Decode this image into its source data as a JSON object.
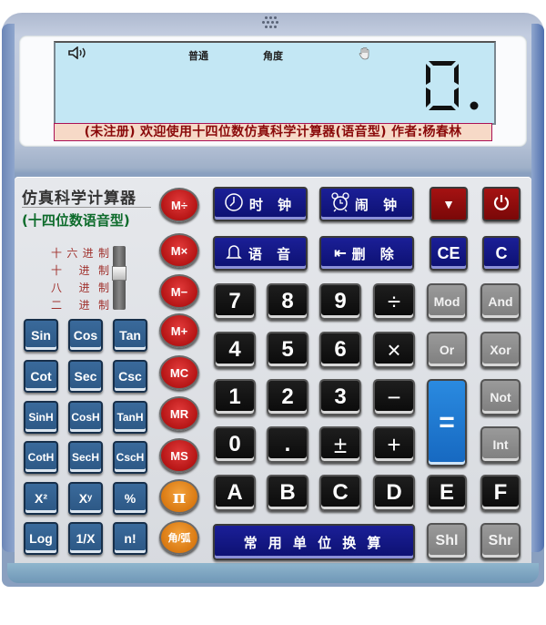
{
  "display": {
    "sound_icon": "speaker-icon",
    "mode_label": "普通",
    "angle_label": "角度",
    "hand_icon": "hand-icon",
    "value": "0."
  },
  "banner": "(未注册) 欢迎使用十四位数仿真科学计算器(语音型) 作者:杨春林",
  "branding": {
    "title": "仿真科学计算器",
    "subtitle": "(十四位数语音型)"
  },
  "base_selector": {
    "options": [
      [
        "十",
        "六",
        "进",
        "制"
      ],
      [
        "十",
        "",
        "进",
        "制"
      ],
      [
        "八",
        "",
        "进",
        "制"
      ],
      [
        "二",
        "",
        "进",
        "制"
      ]
    ],
    "selected_index": 1
  },
  "top_keys": {
    "clock": "时 钟",
    "alarm": "闹 钟",
    "voice": "语 音",
    "delete": "删 除",
    "delete_icon": "⇤",
    "dropdown": "▼",
    "power": "⏻",
    "ce": "CE",
    "c": "C"
  },
  "memory_keys": [
    "M÷",
    "M×",
    "M−",
    "M+",
    "MC",
    "MR",
    "MS"
  ],
  "special_keys": [
    "π",
    "角/弧"
  ],
  "sci_keys": [
    [
      "Sin",
      "Cos",
      "Tan"
    ],
    [
      "Cot",
      "Sec",
      "Csc"
    ],
    [
      "SinH",
      "CosH",
      "TanH"
    ],
    [
      "CotH",
      "SecH",
      "CscH"
    ],
    [
      "X²",
      "Xʸ",
      "%"
    ],
    [
      "Log",
      "1/X",
      "n!"
    ]
  ],
  "num_keys": [
    [
      "7",
      "8",
      "9",
      "÷"
    ],
    [
      "4",
      "5",
      "6",
      "×"
    ],
    [
      "1",
      "2",
      "3",
      "−"
    ],
    [
      "0",
      ".",
      "±",
      "+"
    ],
    [
      "A",
      "B",
      "C",
      "D"
    ]
  ],
  "logic_keys": {
    "mod": "Mod",
    "and": "And",
    "or": "Or",
    "xor": "Xor",
    "not": "Not",
    "int": "Int",
    "e": "E",
    "f": "F",
    "shl": "Shl",
    "shr": "Shr",
    "equals": "="
  },
  "unit_convert": "常 用 单 位 换 算"
}
